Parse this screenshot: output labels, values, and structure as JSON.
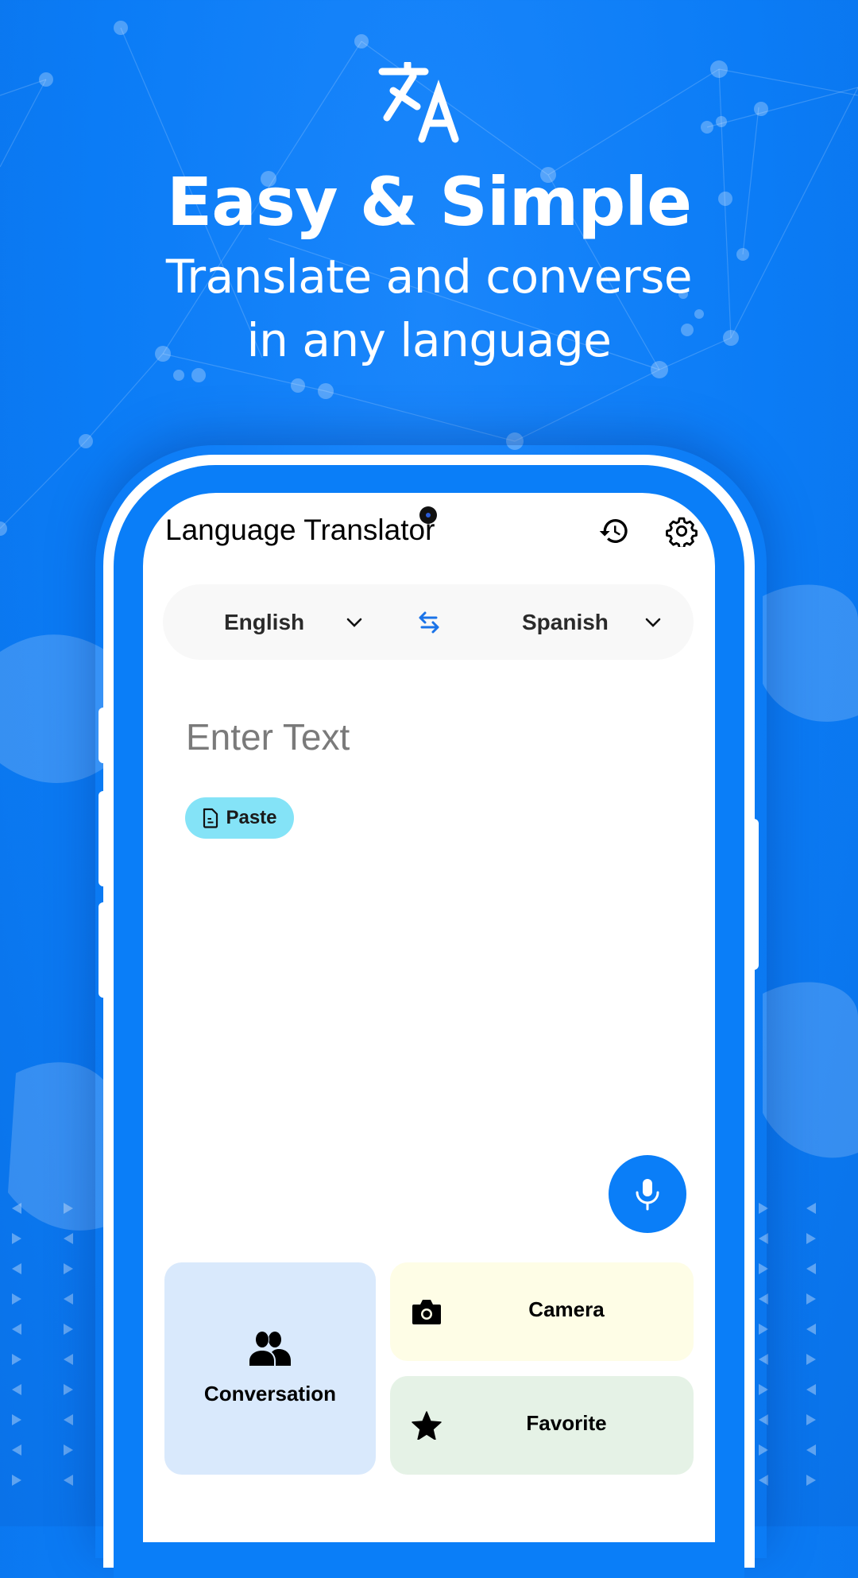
{
  "hero": {
    "icon": "translate-icon",
    "title": "Easy & Simple",
    "subtitle_line1": "Translate and converse",
    "subtitle_line2": "in any language"
  },
  "app": {
    "title": "Language Translator",
    "header_icons": [
      "history-icon",
      "gear-icon"
    ]
  },
  "language_bar": {
    "source_language": "English",
    "target_language": "Spanish",
    "swap_icon": "swap-arrows-icon",
    "swap_color": "#1a73e8"
  },
  "input": {
    "placeholder": "Enter Text",
    "value": ""
  },
  "paste_button": {
    "label": "Paste",
    "icon": "document-icon",
    "color": "#84e3f7"
  },
  "mic_button": {
    "icon": "microphone-icon",
    "color": "#0a7ef8"
  },
  "actions": [
    {
      "label": "Conversation",
      "icon": "people-icon",
      "color": "#d9e9fc"
    },
    {
      "label": "Camera",
      "icon": "camera-icon",
      "color": "#fefde6"
    },
    {
      "label": "Favorite",
      "icon": "star-icon",
      "color": "#e5f2e6"
    }
  ],
  "colors": {
    "background": "#0b7cf6",
    "phone_bezel": "#0a7ef8"
  }
}
